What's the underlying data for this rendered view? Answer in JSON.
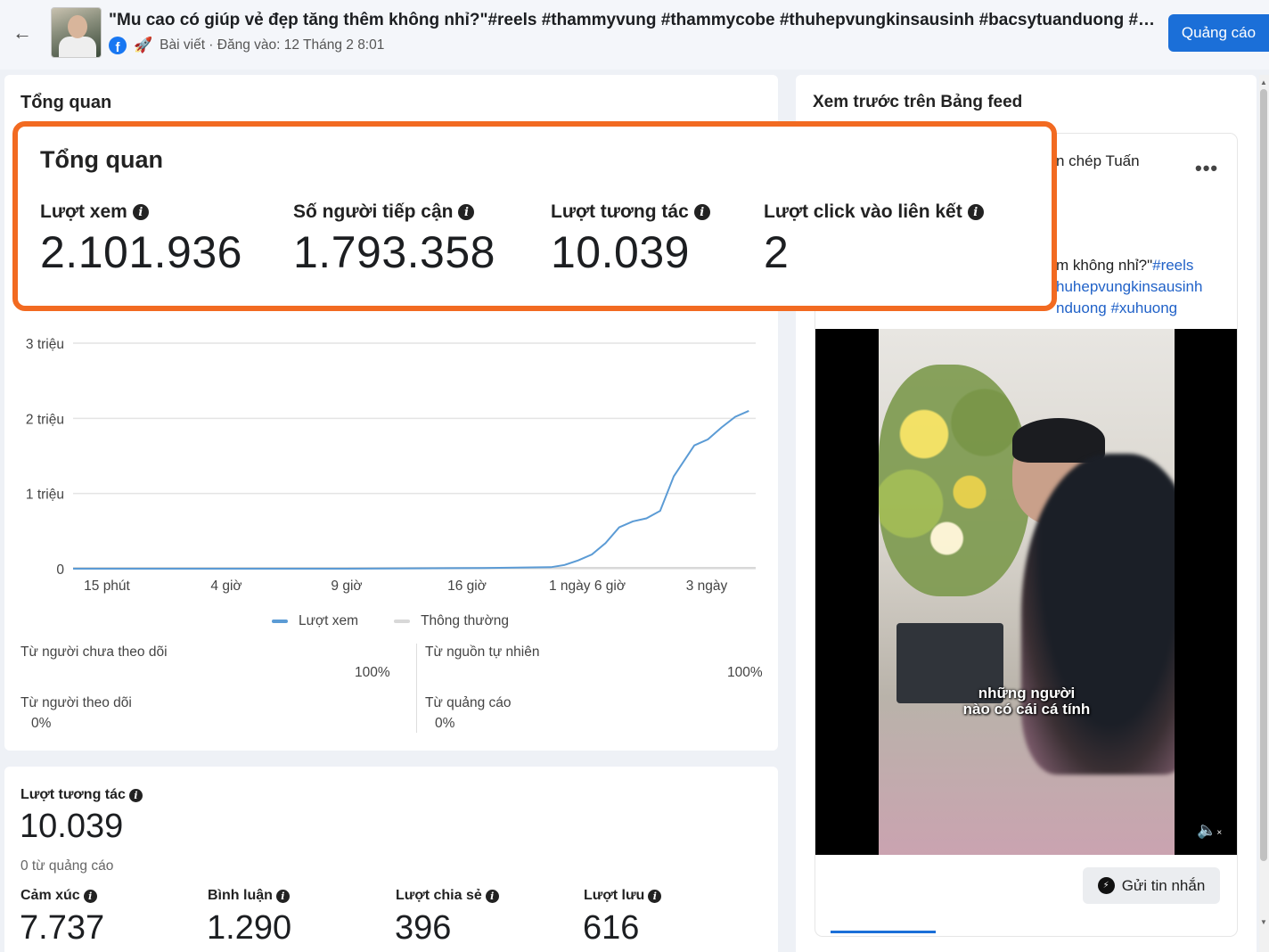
{
  "header": {
    "post_title": "\"Mu cao có giúp vẻ đẹp tăng thêm không nhỉ?\"#reels #thammyvung #thammycobe #thuhepvungkinsausinh #bacsytuanduong #th...",
    "post_meta": "Bài viết · Đăng vào: 12 Tháng 2 8:01",
    "ad_button": "Quảng cáo"
  },
  "overview": {
    "section_title": "Tổng quan",
    "highlight_title": "Tổng quan",
    "metrics": [
      {
        "label": "Lượt xem",
        "value": "2.101.936"
      },
      {
        "label": "Số người tiếp cận",
        "value": "1.793.358"
      },
      {
        "label": "Lượt tương tác",
        "value": "10.039"
      },
      {
        "label": "Lượt click vào liên kết",
        "value": "2"
      }
    ],
    "legend": {
      "views": "Lượt xem",
      "typical": "Thông thường"
    },
    "split": {
      "non_followers_label": "Từ người chưa theo dõi",
      "non_followers_pct": "100%",
      "followers_label": "Từ người theo dõi",
      "followers_pct": "0%",
      "organic_label": "Từ nguồn tự nhiên",
      "organic_pct": "100%",
      "ads_label": "Từ quảng cáo",
      "ads_pct": "0%"
    }
  },
  "chart_data": {
    "type": "line",
    "series": [
      {
        "name": "Lượt xem",
        "color": "#5b9bd5",
        "points": [
          [
            0.0,
            0
          ],
          [
            0.1,
            0
          ],
          [
            0.2,
            0
          ],
          [
            0.3,
            0
          ],
          [
            0.4,
            0
          ],
          [
            0.5,
            0.005
          ],
          [
            0.6,
            0.01
          ],
          [
            0.7,
            0.02
          ],
          [
            0.72,
            0.05
          ],
          [
            0.74,
            0.11
          ],
          [
            0.76,
            0.19
          ],
          [
            0.78,
            0.34
          ],
          [
            0.8,
            0.55
          ],
          [
            0.82,
            0.63
          ],
          [
            0.84,
            0.67
          ],
          [
            0.86,
            0.77
          ],
          [
            0.88,
            1.23
          ],
          [
            0.91,
            1.64
          ],
          [
            0.93,
            1.72
          ],
          [
            0.95,
            1.88
          ],
          [
            0.97,
            2.02
          ],
          [
            0.99,
            2.1
          ]
        ]
      }
    ],
    "x_ticks": [
      "15 phút",
      "4 giờ",
      "9 giờ",
      "16 giờ",
      "1 ngày 6 giờ",
      "3 ngày"
    ],
    "y_ticks": [
      "0",
      "1 triệu",
      "2 triệu",
      "3 triệu"
    ],
    "ylim": [
      0,
      3
    ],
    "y_unit": "triệu",
    "grid": true,
    "legend": [
      "Lượt xem",
      "Thông thường"
    ]
  },
  "engagement": {
    "title": "Lượt tương tác",
    "value": "10.039",
    "sub": "0 từ quảng cáo",
    "items": [
      {
        "label": "Cảm xúc",
        "value": "7.737"
      },
      {
        "label": "Bình luận",
        "value": "1.290"
      },
      {
        "label": "Lượt chia sẻ",
        "value": "396"
      },
      {
        "label": "Lượt lưu",
        "value": "616"
      }
    ]
  },
  "preview": {
    "title": "Xem trước trên Bảng feed",
    "author": "n chép Tuấn",
    "caption_line1_text": "m không nhỉ?\"",
    "caption_line1_tag": "#reels",
    "caption_line2": "huhepvungkinsausinh",
    "caption_line3": "nduong #xuhuong",
    "video_subtitle_1": "những người",
    "video_subtitle_2": "nào có cái cá tính",
    "message_button": "Gửi tin nhắn"
  }
}
